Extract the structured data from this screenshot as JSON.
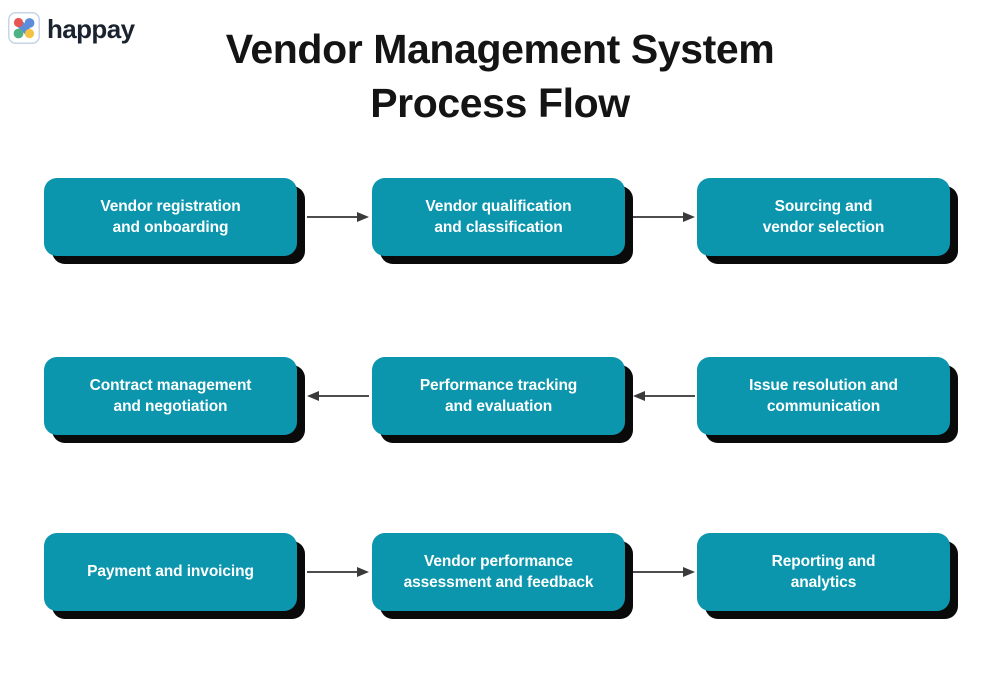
{
  "brand": {
    "name": "happay",
    "logo_icon": "happay-logo-icon",
    "logo_colors": {
      "red": "#e8544f",
      "blue": "#5b8ddb",
      "green": "#4fb286",
      "yellow": "#f5c242",
      "frame": "#c9d4ea"
    }
  },
  "header": {
    "title_line_1": "Vendor Management System",
    "title_line_2": "Process Flow",
    "title_color": "#141414"
  },
  "theme": {
    "node_fill": "#0b96ad",
    "node_text": "#ffffff",
    "node_shadow": "#0a0a0a",
    "arrow_color": "#4d4d4d",
    "background": "#ffffff"
  },
  "flow": {
    "rows": [
      {
        "direction": "right",
        "nodes": [
          {
            "id": "vendor-registration-and-onboarding",
            "label": "Vendor registration\nand onboarding"
          },
          {
            "id": "vendor-qualification-and-classification",
            "label": "Vendor qualification\nand classification"
          },
          {
            "id": "sourcing-and-vendor-selection",
            "label": "Sourcing and\nvendor selection"
          }
        ]
      },
      {
        "direction": "left",
        "nodes": [
          {
            "id": "contract-management-and-negotiation",
            "label": "Contract management\nand negotiation"
          },
          {
            "id": "performance-tracking-and-evaluation",
            "label": "Performance tracking\nand evaluation"
          },
          {
            "id": "issue-resolution-and-communication",
            "label": "Issue resolution and\ncommunication"
          }
        ]
      },
      {
        "direction": "right",
        "nodes": [
          {
            "id": "payment-and-invoicing",
            "label": "Payment and invoicing"
          },
          {
            "id": "vendor-performance-assessment-and-feedback",
            "label": "Vendor performance\nassessment and feedback"
          },
          {
            "id": "reporting-and-analytics",
            "label": "Reporting and\nanalytics"
          }
        ]
      }
    ]
  }
}
